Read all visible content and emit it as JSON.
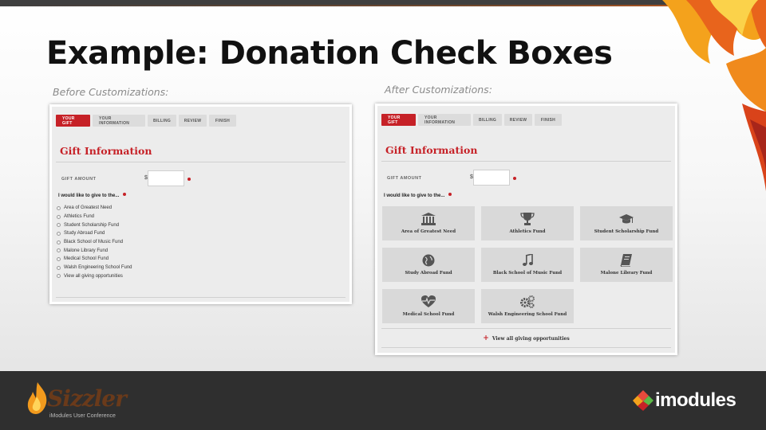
{
  "slide": {
    "title": "Example: Donation Check Boxes",
    "caption_before": "Before Customizations:",
    "caption_after": "After Customizations:"
  },
  "form": {
    "steps": [
      "YOUR GIFT",
      "YOUR INFORMATION",
      "BILLING",
      "REVIEW",
      "FINISH"
    ],
    "heading": "Gift Information",
    "amount_label": "GIFT AMOUNT",
    "currency": "$",
    "amount_value": "",
    "give_label": "I would like to give to the...",
    "accent_color": "#c62127"
  },
  "before": {
    "funds": [
      "Area of Greatest Need",
      "Athletics Fund",
      "Student Scholarship Fund",
      "Study Abroad Fund",
      "Black School of Music Fund",
      "Malone Library Fund",
      "Medical School Fund",
      "Walsh Engineering School Fund",
      "View all giving opportunities"
    ]
  },
  "after": {
    "tiles": [
      {
        "label": "Area of Greatest Need",
        "icon": "institution-icon"
      },
      {
        "label": "Athletics Fund",
        "icon": "trophy-icon"
      },
      {
        "label": "Student Scholarship Fund",
        "icon": "graduation-cap-icon"
      },
      {
        "label": "Study Abroad Fund",
        "icon": "globe-icon"
      },
      {
        "label": "Black School of Music Fund",
        "icon": "music-note-icon"
      },
      {
        "label": "Malone Library Fund",
        "icon": "book-icon"
      },
      {
        "label": "Medical School Fund",
        "icon": "heartbeat-icon"
      },
      {
        "label": "Walsh Engineering School Fund",
        "icon": "gears-icon"
      }
    ],
    "view_all": "View all giving opportunities"
  },
  "footer": {
    "sizzler_name": "Sizzler",
    "sizzler_sub": "iModules User Conference",
    "brand": "imodules"
  }
}
